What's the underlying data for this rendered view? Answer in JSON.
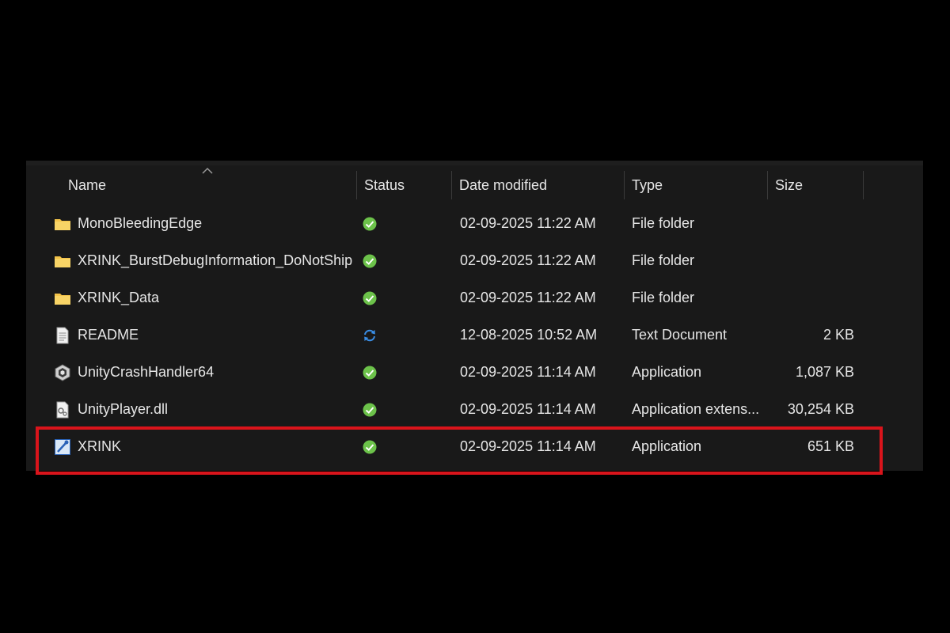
{
  "columns": {
    "name": "Name",
    "status": "Status",
    "date_modified": "Date modified",
    "type": "Type",
    "size": "Size"
  },
  "files": [
    {
      "name": "MonoBleedingEdge",
      "icon": "folder-icon",
      "status": "synced",
      "date": "02-09-2025 11:22 AM",
      "type": "File folder",
      "size": ""
    },
    {
      "name": "XRINK_BurstDebugInformation_DoNotShip",
      "icon": "folder-icon",
      "status": "synced",
      "date": "02-09-2025 11:22 AM",
      "type": "File folder",
      "size": ""
    },
    {
      "name": "XRINK_Data",
      "icon": "folder-icon",
      "status": "synced",
      "date": "02-09-2025 11:22 AM",
      "type": "File folder",
      "size": ""
    },
    {
      "name": "README",
      "icon": "text-document-icon",
      "status": "syncing",
      "date": "12-08-2025 10:52 AM",
      "type": "Text Document",
      "size": "2 KB"
    },
    {
      "name": "UnityCrashHandler64",
      "icon": "unity-app-icon",
      "status": "synced",
      "date": "02-09-2025 11:14 AM",
      "type": "Application",
      "size": "1,087 KB"
    },
    {
      "name": "UnityPlayer.dll",
      "icon": "dll-file-icon",
      "status": "synced",
      "date": "02-09-2025 11:14 AM",
      "type": "Application extens...",
      "size": "30,254 KB"
    },
    {
      "name": "XRINK",
      "icon": "xrink-app-icon",
      "status": "synced",
      "date": "02-09-2025 11:14 AM",
      "type": "Application",
      "size": "651 KB"
    }
  ],
  "highlighted_file": "XRINK",
  "colors": {
    "background": "#000000",
    "panel": "#191919",
    "text": "#e6e6e6",
    "synced_green": "#6cc24a",
    "syncing_blue": "#3a8ee6",
    "folder_yellow": "#f3c349",
    "highlight_red": "#d9141b"
  }
}
